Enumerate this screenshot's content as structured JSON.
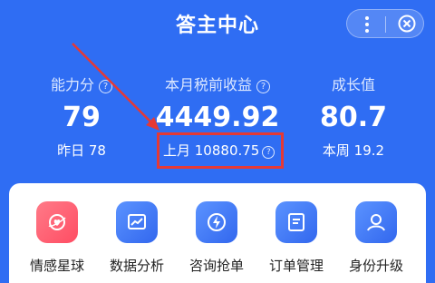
{
  "header": {
    "title": "答主中心"
  },
  "stats": {
    "ability": {
      "label": "能力分",
      "value": "79",
      "sub": "昨日 78"
    },
    "income": {
      "label": "本月税前收益",
      "value": "4449.92",
      "sub": "上月 10880.75"
    },
    "growth": {
      "label": "成长值",
      "value": "80.7",
      "sub": "本周 19.2"
    }
  },
  "menu": [
    {
      "label": "情感星球",
      "icon": "heart-planet-icon",
      "color": "#ff5a6e"
    },
    {
      "label": "数据分析",
      "icon": "chart-icon",
      "color": "#3d7cf5"
    },
    {
      "label": "咨询抢单",
      "icon": "lightning-icon",
      "color": "#3d7cf5"
    },
    {
      "label": "订单管理",
      "icon": "document-icon",
      "color": "#3d7cf5"
    },
    {
      "label": "身份升级",
      "icon": "person-icon",
      "color": "#3d7cf5"
    }
  ],
  "colors": {
    "background": "#2f6df3",
    "highlight": "#e53935"
  }
}
